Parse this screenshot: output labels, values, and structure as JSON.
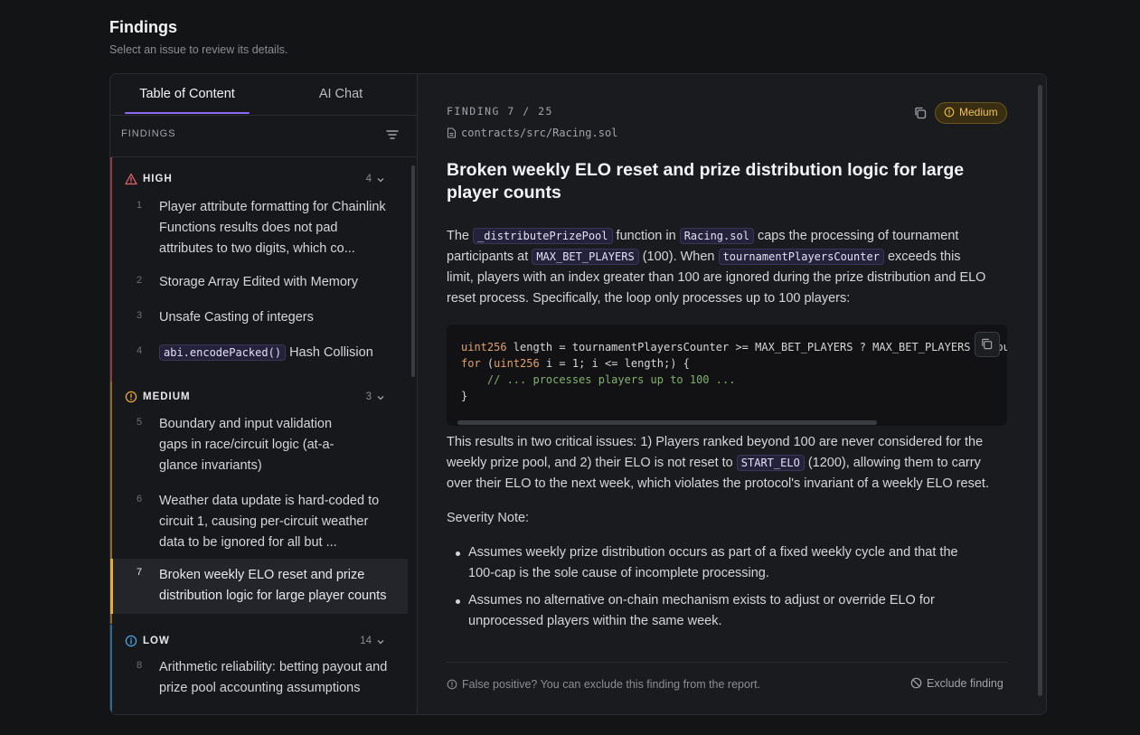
{
  "page": {
    "title": "Findings",
    "subtitle": "Select an issue to review its details."
  },
  "tabs": [
    {
      "label": "Table of Content",
      "active": true
    },
    {
      "label": "AI Chat",
      "active": false
    }
  ],
  "sidebar": {
    "header": "FINDINGS",
    "groups": {
      "high": {
        "label": "HIGH",
        "count": "4",
        "color": "#e0656a"
      },
      "medium": {
        "label": "MEDIUM",
        "count": "3",
        "color": "#e7a93a"
      },
      "low": {
        "label": "LOW",
        "count": "14",
        "color": "#4ea3d9"
      }
    },
    "items": [
      {
        "num": "1",
        "lines": [
          "Player attribute formatting for Chainlink",
          "Functions results does not pad",
          "attributes to two digits, which co..."
        ]
      },
      {
        "num": "2",
        "text": "Storage Array Edited with Memory"
      },
      {
        "num": "3",
        "text": "Unsafe Casting of integers"
      },
      {
        "num": "4",
        "code": "abi.encodePacked()",
        "text": " Hash Collision"
      },
      {
        "num": "5",
        "lines": [
          "Boundary and input validation",
          "gaps in race/circuit logic (at-a-",
          "glance invariants)"
        ]
      },
      {
        "num": "6",
        "lines": [
          "Weather data update is hard-coded to",
          "circuit 1, causing per-circuit weather",
          "data to be ignored for all but ..."
        ]
      },
      {
        "num": "7",
        "lines": [
          "Broken weekly ELO reset and prize",
          "distribution logic for large player counts"
        ],
        "active": true
      },
      {
        "num": "8",
        "lines": [
          "Arithmetic reliability: betting payout and",
          "prize pool accounting assumptions"
        ]
      }
    ]
  },
  "finding": {
    "counter": "FINDING 7 / 25",
    "file": "contracts/src/Racing.sol",
    "severity": "Medium",
    "title_lines": [
      "Broken weekly ELO reset and prize distribution logic for large",
      "player counts"
    ],
    "p1": {
      "t1": "The ",
      "c1": "_distributePrizePool",
      "t2": " function in ",
      "c2": "Racing.sol",
      "t3": " caps the processing of tournament",
      "t4": "participants at ",
      "c3": "MAX_BET_PLAYERS",
      "t5": " (100). When ",
      "c4": "tournamentPlayersCounter",
      "t6": " exceeds this",
      "t7": "limit, players with an index greater than 100 are ignored during the prize distribution and ELO",
      "t8": "reset process. Specifically, the loop only processes up to 100 players:"
    },
    "code": {
      "l1_type": "uint256",
      "l1_rest": " length = tournamentPlayersCounter >= MAX_BET_PLAYERS ? MAX_BET_PLAYERS : tournamentPlayersCounter;",
      "l2_kw": "for",
      "l2_a": " (",
      "l2_type": "uint256",
      "l2_rest": " i = 1; i <= length;) {",
      "l3": "    // ... processes players up to 100 ...",
      "l4": "}"
    },
    "p2": {
      "t1": "This results in two critical issues: 1) Players ranked beyond 100 are never considered for the",
      "t2": "weekly prize pool, and 2) their ELO is not reset to ",
      "c1": "START_ELO",
      "t3": " (1200), allowing them to carry",
      "t4": "over their ELO to the next week, which violates the protocol's invariant of a weekly ELO reset."
    },
    "severity_note": "Severity Note:",
    "bullets": [
      [
        "Assumes weekly prize distribution occurs as part of a fixed weekly cycle and that the",
        "100-cap is the sole cause of incomplete processing."
      ],
      [
        "Assumes no alternative on-chain mechanism exists to adjust or override ELO for",
        "unprocessed players within the same week."
      ]
    ],
    "footer_note": "False positive? You can exclude this finding from the report.",
    "exclude_label": "Exclude finding"
  }
}
